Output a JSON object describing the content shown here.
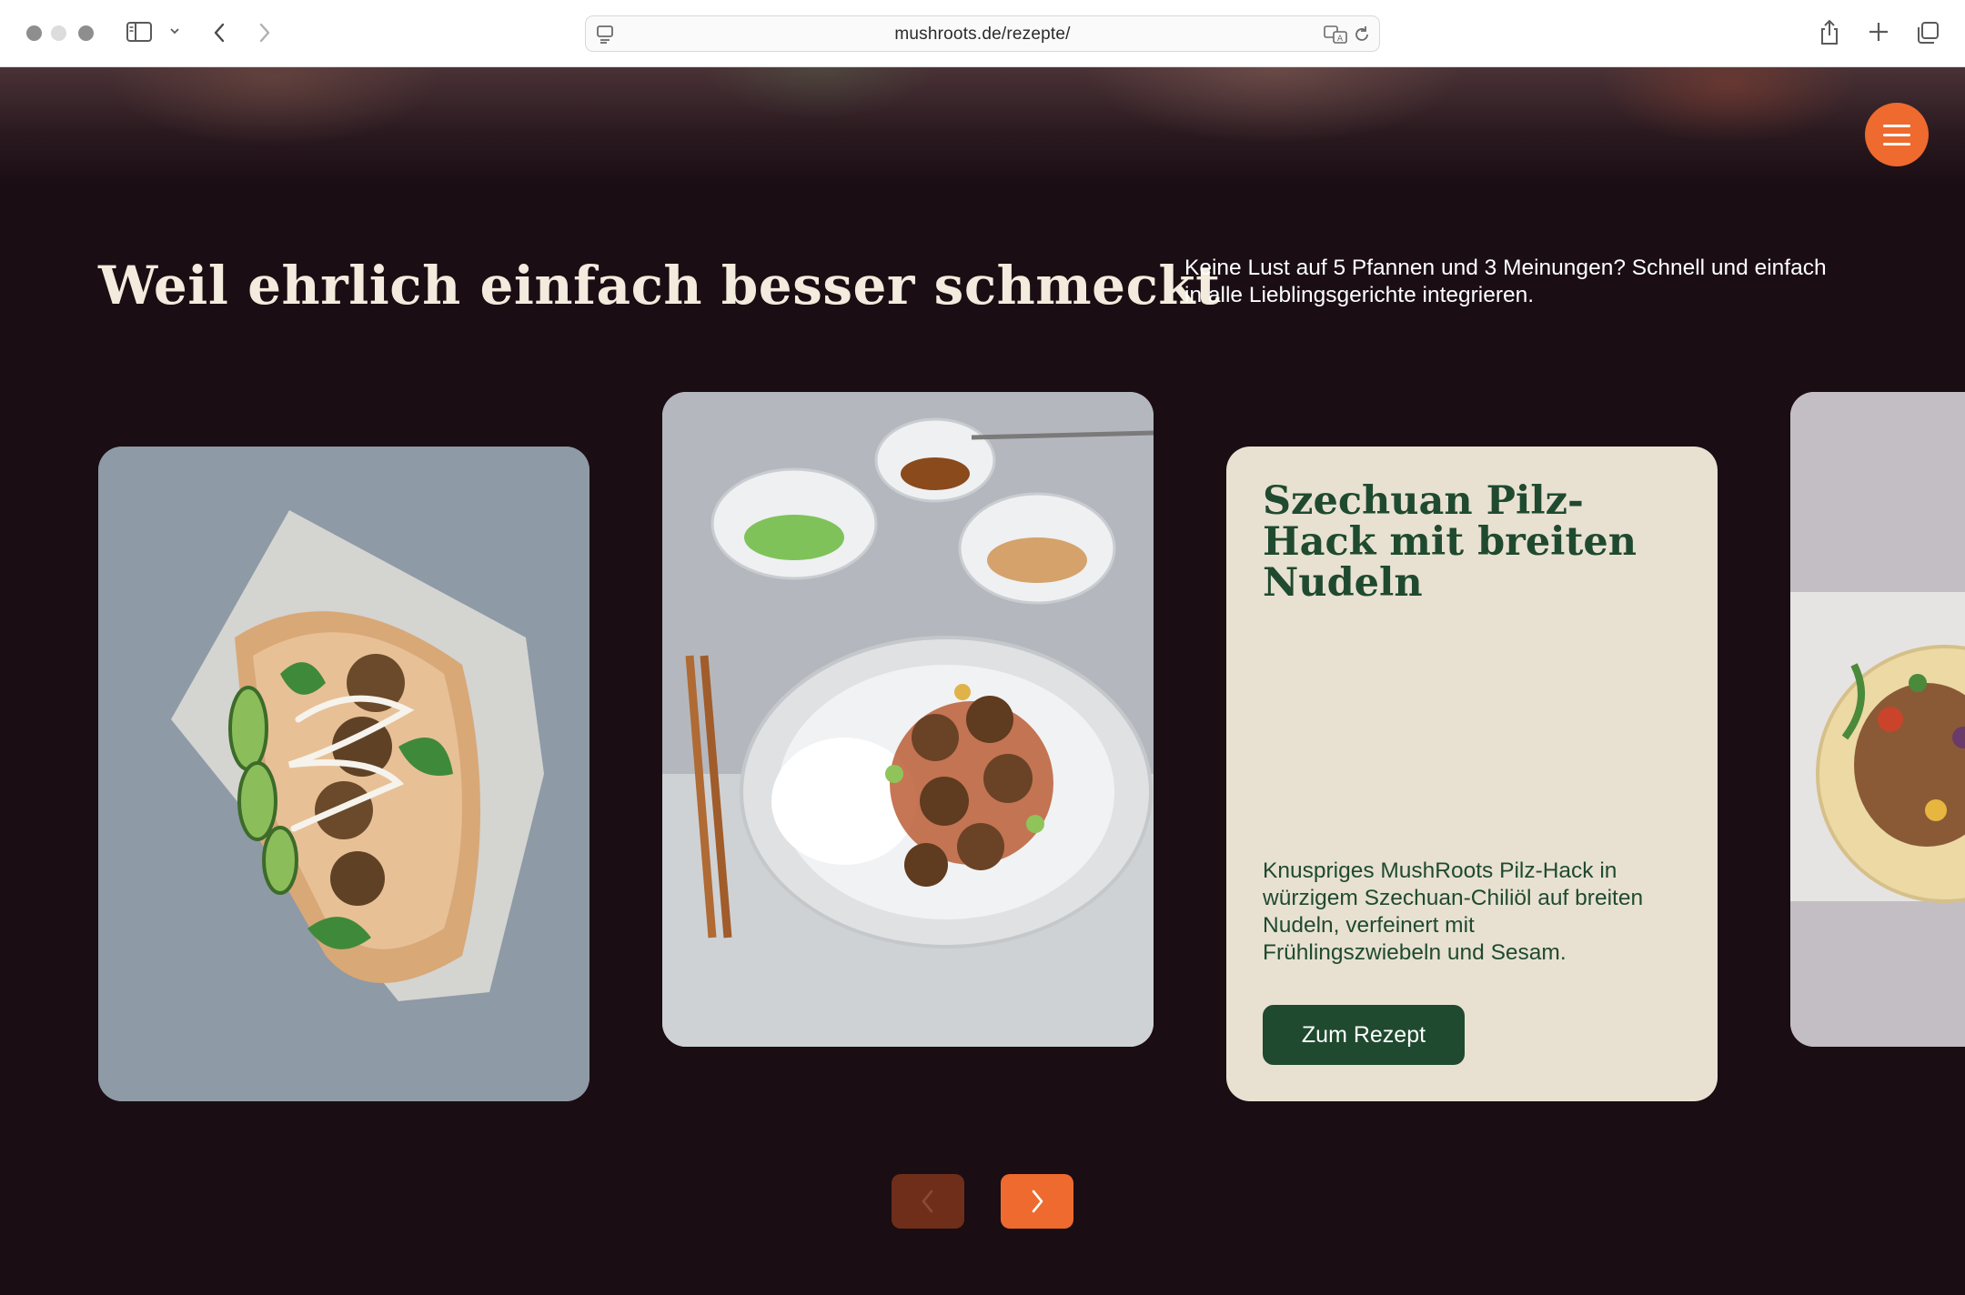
{
  "browser": {
    "url": "mushroots.de/rezepte/"
  },
  "page": {
    "headline": "Weil ehrlich einfach besser schmeckt",
    "intro": "Keine Lust auf 5 Pfannen und 3 Meinungen? Schnell und einfach in alle Lieblingsgerichte integrieren."
  },
  "carousel": {
    "featured_card": {
      "title": "Szechuan Pilz-Hack mit breiten Nudeln",
      "description": "Knuspriges MushRoots Pilz-Hack in würzigem Szechuan-Chiliöl auf breiten Nudeln, verfeinert mit Frühlingszwiebeln und Sesam.",
      "button_label": "Zum Rezept"
    }
  },
  "colors": {
    "page_bg": "#1a0d13",
    "accent": "#ee6a2e",
    "card_bg": "#e8e1d2",
    "brand_green": "#1f4a2f",
    "headline": "#f3ebdd"
  }
}
